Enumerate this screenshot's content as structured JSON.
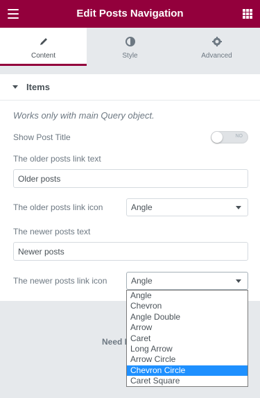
{
  "header": {
    "title": "Edit Posts Navigation"
  },
  "tabs": [
    {
      "label": "Content",
      "icon": "pencil-icon"
    },
    {
      "label": "Style",
      "icon": "half-circle-icon"
    },
    {
      "label": "Advanced",
      "icon": "gear-icon"
    }
  ],
  "section": {
    "title": "Items"
  },
  "note": "Works only with main Query object.",
  "show_post_title": {
    "label": "Show Post Title",
    "toggle_text": "NO"
  },
  "older_text": {
    "label": "The older posts link text",
    "value": "Older posts"
  },
  "older_icon": {
    "label": "The older posts link icon",
    "value": "Angle"
  },
  "newer_text": {
    "label": "The newer posts text",
    "value": "Newer posts"
  },
  "newer_icon": {
    "label": "The newer posts link icon",
    "value": "Angle"
  },
  "need_help": "Need H",
  "dropdown": {
    "options": [
      "Angle",
      "Chevron",
      "Angle Double",
      "Arrow",
      "Caret",
      "Long Arrow",
      "Arrow Circle",
      "Chevron Circle",
      "Caret Square"
    ],
    "highlighted": "Chevron Circle"
  },
  "colors": {
    "brand": "#93003c",
    "highlight": "#1e90ff"
  }
}
